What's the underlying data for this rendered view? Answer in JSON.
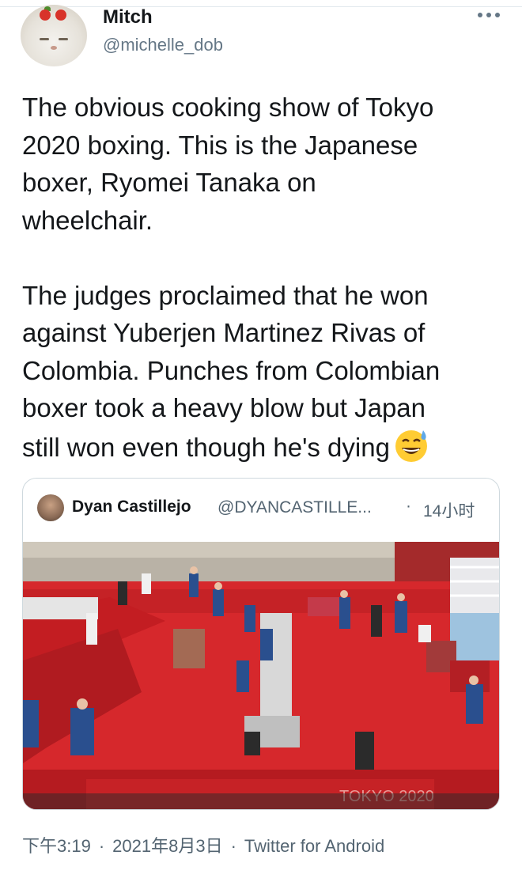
{
  "user": {
    "display_name": "Mitch",
    "handle": "@michelle_dob"
  },
  "menu": {
    "more_icon": "more-horizontal-icon"
  },
  "tweet": {
    "paragraph1": "The obvious cooking show of Tokyo\n2020 boxing. This is the Japanese\nboxer, Ryomei Tanaka on\nwheelchair.",
    "paragraph2": "The judges proclaimed that he won\nagainst Yuberjen Martinez Rivas of\nColombia. Punches from Colombian\nboxer took a heavy blow but Japan\nstill won even though he's dying",
    "emoji": "grinning-face-with-sweat-icon"
  },
  "quoted_tweet": {
    "display_name": "Dyan Castillejo",
    "handle": "@DYANCASTILLE...",
    "separator": "·",
    "time": "14小时",
    "media_watermark": "TOKYO 2020"
  },
  "footer": {
    "time": "下午3:19",
    "separator": "·",
    "date": "2021年8月3日",
    "source": "Twitter for Android"
  },
  "colors": {
    "text": "#14171a",
    "secondary": "#657786",
    "border": "#cfd9de",
    "arena_floor": "#d6282c"
  }
}
